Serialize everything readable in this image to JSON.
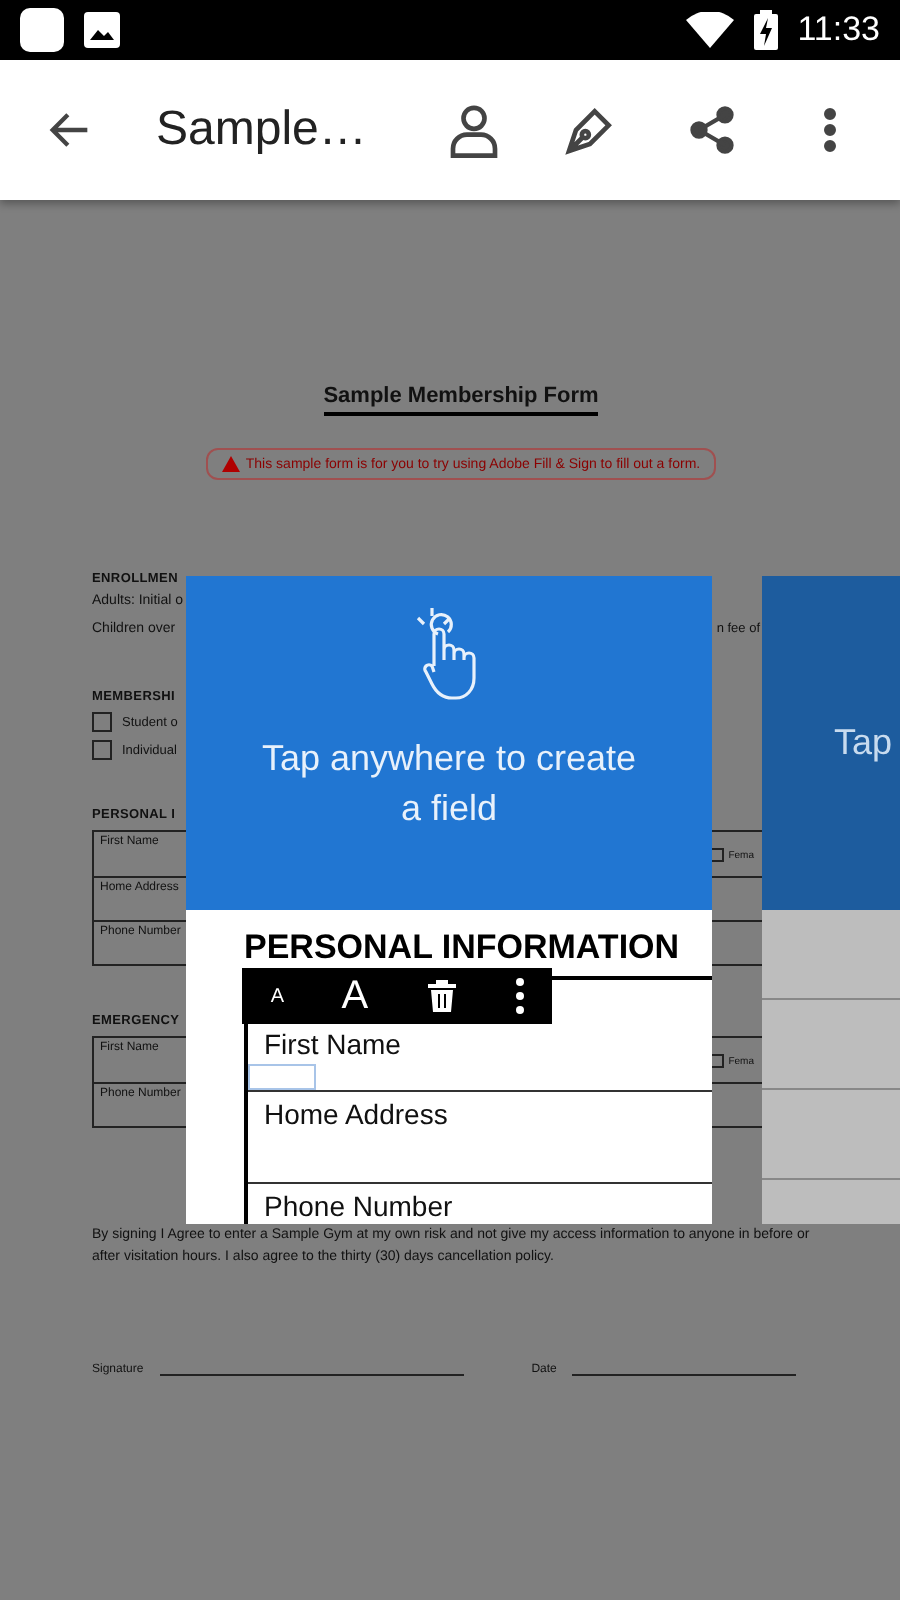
{
  "status_bar": {
    "time": "11:33"
  },
  "app_bar": {
    "title": "Sample…"
  },
  "document": {
    "title": "Sample Membership Form",
    "notice": "This sample form is for you to try using Adobe Fill & Sign to fill out a form.",
    "blocks": [
      {
        "kind": "heading",
        "text": "ENROLLMEN"
      },
      {
        "kind": "line",
        "text": "Adults: Initial o"
      },
      {
        "kind": "line",
        "text": "Children over",
        "right": "n fee of"
      },
      {
        "kind": "heading",
        "text": "MEMBERSHI"
      },
      {
        "kind": "checkbox",
        "text": "Student o",
        "checked": false
      },
      {
        "kind": "checkbox",
        "text": "Individual",
        "checked": false
      },
      {
        "kind": "heading",
        "text": "PERSONAL I"
      },
      {
        "kind": "table",
        "rows": [
          {
            "label": "First Name",
            "right": "Fema",
            "checked": false
          },
          {
            "label": "Home Address"
          },
          {
            "label": "Phone Number"
          }
        ]
      },
      {
        "kind": "heading",
        "text": "EMERGENCY"
      },
      {
        "kind": "table",
        "rows": [
          {
            "label": "First Name",
            "right": "Fema",
            "checked": false
          },
          {
            "label": "Phone Number"
          }
        ]
      },
      {
        "kind": "paragraph",
        "text": "By signing I Agree to enter a Sample Gym at my own risk and not give my access information to anyone in before or after visitation hours. I also agree to the thirty (30) days cancellation policy."
      },
      {
        "kind": "signature",
        "labels": [
          "Signature",
          "Date"
        ]
      }
    ]
  },
  "tutorial_cards": [
    {
      "kind": "full",
      "text": "Tap anywhere to create a field",
      "preview": {
        "heading": "PERSONAL INFORMATION",
        "fields": [
          "First Name",
          "Home Address",
          "Phone Number"
        ]
      },
      "toolbar": {
        "small": "A",
        "large": "A"
      }
    },
    {
      "kind": "peek",
      "text": "Tap"
    }
  ]
}
